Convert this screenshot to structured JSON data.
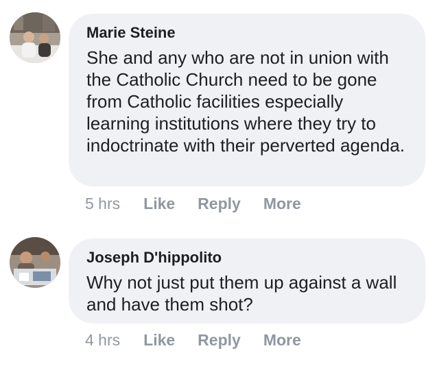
{
  "comments": [
    {
      "author": "Marie Steine",
      "text": "She and any who are not in union with the Catholic Church need to be gone from Catholic facilities especially learning institutions where they try to indoctrinate with their perverted agenda.",
      "time": "5 hrs",
      "actions": {
        "like": "Like",
        "reply": "Reply",
        "more": "More"
      }
    },
    {
      "author": "Joseph D'hippolito",
      "text": "Why not just put them up against a wall and have them shot?",
      "time": "4 hrs",
      "actions": {
        "like": "Like",
        "reply": "Reply",
        "more": "More"
      }
    }
  ],
  "colors": {
    "bubble_background": "#f0f1f4",
    "text": "#1c1e21",
    "meta": "#9097a1"
  }
}
